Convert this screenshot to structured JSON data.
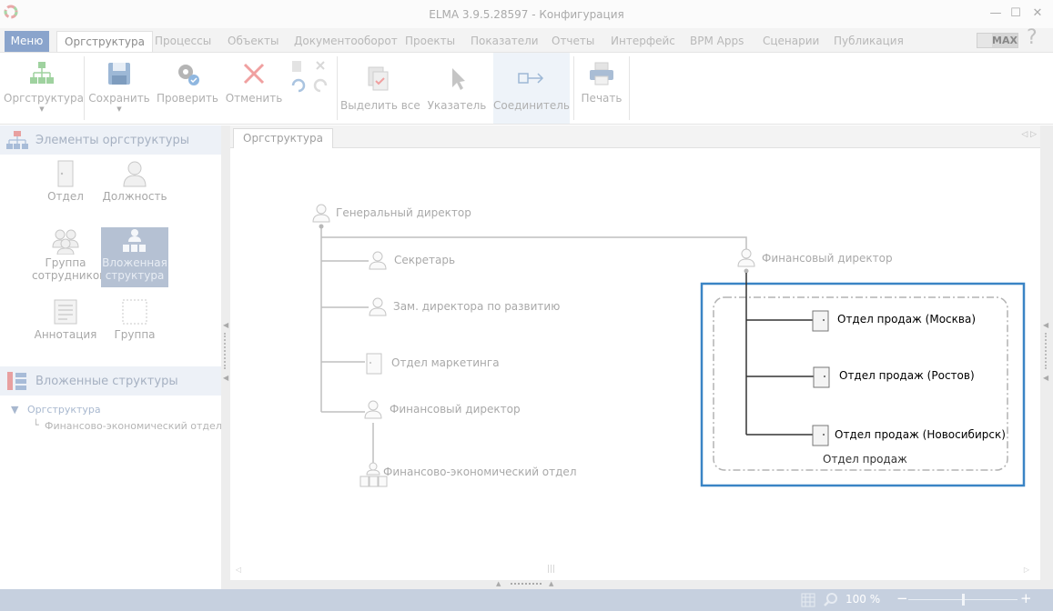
{
  "window": {
    "title": "ELMA 3.9.5.28597 - Конфигурация",
    "minimize": "—",
    "maximize": "☐",
    "close": "✕"
  },
  "ribbon_tabs": {
    "menu": "Меню",
    "items": [
      "Оргструктура",
      "Процессы",
      "Объекты",
      "Документооборот",
      "Проекты",
      "Показатели",
      "Отчеты",
      "Интерфейс",
      "BPM Apps",
      "Сценарии",
      "Публикация"
    ],
    "max_badge": "MAX",
    "help": "?"
  },
  "ribbon": {
    "orgstructure": "Оргструктура",
    "save": "Сохранить",
    "check": "Проверить",
    "cancel": "Отменить",
    "select_all": "Выделить все",
    "pointer": "Указатель",
    "connector": "Соединитель",
    "print": "Печать"
  },
  "left_panel": {
    "elements_title": "Элементы оргструктуры",
    "tools": {
      "department": "Отдел",
      "position": "Должность",
      "group_staff": "Группа сотрудников",
      "nested_structure": "Вложенная структура",
      "annotation": "Аннотация",
      "group": "Группа"
    },
    "nested_title": "Вложенные структуры",
    "tree": {
      "root": "Оргструктура",
      "child": "Финансово-экономический отдел"
    }
  },
  "document": {
    "tab": "Оргструктура"
  },
  "diagram": {
    "general_director": "Генеральный директор",
    "secretary": "Секретарь",
    "deputy_director": "Зам. директора по развитию",
    "marketing_dept": "Отдел маркетинга",
    "finance_director_left": "Финансовый директор",
    "fin_econ_dept": "Финансово-экономический отдел",
    "finance_director_right": "Финансовый директор",
    "sales_moscow": "Отдел продаж (Москва)",
    "sales_rostov": "Отдел продаж (Ростов)",
    "sales_novosibirsk": "Отдел продаж (Новосибирск)",
    "sales_group": "Отдел продаж"
  },
  "status": {
    "zoom": "100 %",
    "zoom_minus": "−",
    "zoom_plus": "+"
  },
  "colors": {
    "highlight": "#3a84c5",
    "menu": "#8aa4cc",
    "statusbar": "#c6d0df"
  }
}
